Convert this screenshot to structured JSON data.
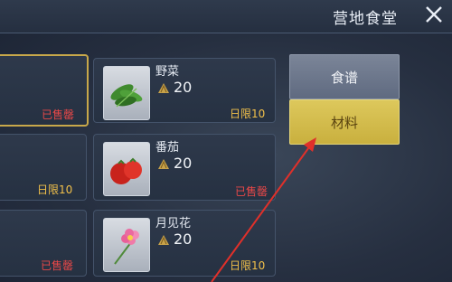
{
  "title": "营地食堂",
  "tabs": [
    {
      "label": "食谱",
      "active": false
    },
    {
      "label": "材料",
      "active": true
    }
  ],
  "items": [
    {
      "name": "",
      "price": "",
      "status": "已售罄"
    },
    {
      "name": "野菜",
      "price": "20",
      "status": "日限10"
    },
    {
      "name": "",
      "price": "",
      "status": "日限10"
    },
    {
      "name": "番茄",
      "price": "20",
      "status": "已售罄"
    },
    {
      "name": "",
      "price": "",
      "status": "已售罄"
    },
    {
      "name": "月见花",
      "price": "20",
      "status": "日限10"
    }
  ],
  "colors": {
    "sold": "#e94848",
    "limit": "#f1c04a",
    "active_tab": "#d6c050",
    "accent_border": "#c8a84a",
    "annotation_arrow": "#e0302a"
  },
  "icons": {
    "price": "shell-icon",
    "close": "close-x-icon"
  }
}
